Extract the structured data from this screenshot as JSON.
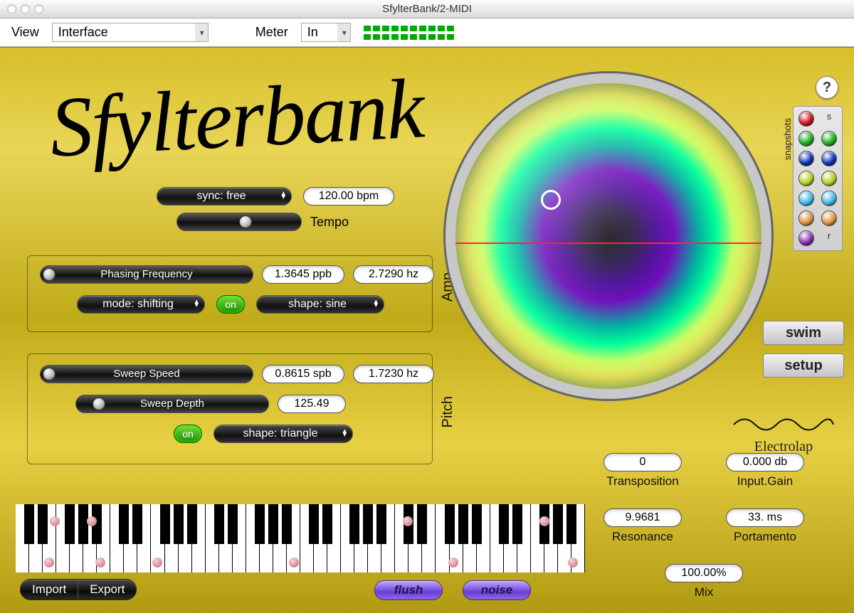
{
  "window": {
    "title": "SfylterBank/2-MIDI"
  },
  "toolbar": {
    "view_label": "View",
    "view_value": "Interface",
    "meter_label": "Meter",
    "meter_value": "In"
  },
  "brand": "Sfylterbank",
  "sync": {
    "label": "sync: free",
    "bpm": "120.00 bpm",
    "tempo_label": "Tempo",
    "tempo_pos": 0.55
  },
  "amp": {
    "section_label": "Amp",
    "phasing_label": "Phasing Frequency",
    "phasing_pos": 0.02,
    "ppb": "1.3645 ppb",
    "hz": "2.7290  hz",
    "mode_label": "mode: shifting",
    "on_label": "on",
    "shape_label": "shape: sine"
  },
  "pitch": {
    "section_label": "Pitch",
    "sweep_speed_label": "Sweep Speed",
    "sweep_speed_pos": 0.02,
    "spb": "0.8615 spb",
    "hz": "1.7230  hz",
    "sweep_depth_label": "Sweep Depth",
    "sweep_depth_pos": 0.12,
    "depth_val": "125.49",
    "on_label": "on",
    "shape_label": "shape: triangle"
  },
  "snapshots": {
    "s": "s",
    "r": "r",
    "colors": [
      "#d01020",
      "#d01020",
      "#18b018",
      "#18b018",
      "#1030b0",
      "#1030b0",
      "#b8d018",
      "#b8d018",
      "#40b8e8",
      "#40b8e8",
      "#e09040",
      "#e09040",
      "#8030b0",
      "#8030b0"
    ]
  },
  "sidebar": {
    "swim": "swim",
    "setup": "setup",
    "brand": "Electrolap"
  },
  "params": {
    "transposition_val": "0",
    "transposition_label": "Transposition",
    "inputgain_val": "0.000 db",
    "inputgain_label": "Input.Gain",
    "resonance_val": "9.9681",
    "resonance_label": "Resonance",
    "portamento_val": "33.  ms",
    "portamento_label": "Portamento",
    "mix_val": "100.00%",
    "mix_label": "Mix"
  },
  "footer": {
    "import": "Import",
    "export": "Export",
    "flush": "flush",
    "noise": "noise"
  },
  "help": "?"
}
